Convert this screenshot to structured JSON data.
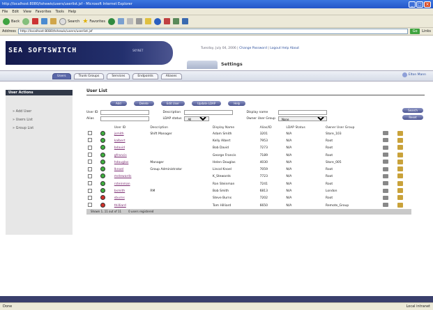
{
  "window": {
    "title": "http://localhost:8080/tshewis/users/userlist.jsf - Microsoft Internet Explorer"
  },
  "menu": [
    "File",
    "Edit",
    "View",
    "Favorites",
    "Tools",
    "Help"
  ],
  "toolbar": {
    "back": "Back",
    "search": "Search",
    "favorites": "Favorites"
  },
  "address": {
    "label": "Address",
    "url": "http://localhost:8080/tshewis/users/userlist.jsf",
    "go": "Go",
    "links": "Links"
  },
  "brand": {
    "logo": "SEA SOFTSWITCH",
    "sub": "SKYNET"
  },
  "topinfo": {
    "date": "Tuesday, July 04, 2006",
    "links": [
      "Change Password",
      "Logout",
      "Help",
      "About"
    ],
    "settings_label": "Settings"
  },
  "tabs": [
    {
      "label": "Users",
      "active": true
    },
    {
      "label": "Trunk Groups",
      "active": false
    },
    {
      "label": "Services",
      "active": false
    },
    {
      "label": "Endpoints",
      "active": false
    },
    {
      "label": "Aliases",
      "active": false
    }
  ],
  "user_link": "Elton Mann",
  "sidebar": {
    "title": "User Actions",
    "items": [
      "Add User",
      "Users List",
      "Group List"
    ]
  },
  "content": {
    "title": "User List"
  },
  "actions": [
    "Add",
    "Delete",
    "Edit User",
    "Update LDAP",
    "Help"
  ],
  "search": {
    "user_id": "User ID",
    "description": "Description",
    "display_name": "Display name",
    "alias": "Alias",
    "ldap_status": "LDAP status",
    "ldap_status_val": "All",
    "owner_group": "Owner User Group",
    "owner_group_val": "None",
    "search_btn": "Search",
    "reset_btn": "Reset"
  },
  "table": {
    "headers": [
      "",
      "",
      "User ID",
      "Description",
      "Display Name",
      "Alias/ID",
      "LDAP Status",
      "Owner User Group",
      "",
      ""
    ],
    "rows": [
      {
        "status": "green",
        "id": "jsmith",
        "desc": "Shift Manager",
        "name": "Adam Smith",
        "alias": "3201",
        "ldap": "N/A",
        "group": "Store_103"
      },
      {
        "status": "green",
        "id": "kalbert",
        "desc": "",
        "name": "Kelly Albert",
        "alias": "7953",
        "ldap": "N/A",
        "group": "Root"
      },
      {
        "status": "green",
        "id": "bdavid",
        "desc": "",
        "name": "Bob David",
        "alias": "7273",
        "ldap": "N/A",
        "group": "Root"
      },
      {
        "status": "green",
        "id": "gfrancis",
        "desc": "",
        "name": "George Francis",
        "alias": "7189",
        "ldap": "N/A",
        "group": "Root"
      },
      {
        "status": "green",
        "id": "hdouglas",
        "desc": "Manager",
        "name": "Helen Douglas",
        "alias": "4030",
        "ldap": "N/A",
        "group": "Store_005"
      },
      {
        "status": "green",
        "id": "lknoel",
        "desc": "Group Administrator",
        "name": "Lincol Knoel",
        "alias": "7059",
        "ldap": "N/A",
        "group": "Root"
      },
      {
        "status": "green",
        "id": "mstewards",
        "desc": "",
        "name": "K_Stewards",
        "alias": "7723",
        "ldap": "N/A",
        "group": "Root"
      },
      {
        "status": "green",
        "id": "rsteinman",
        "desc": "",
        "name": "Ron Steinman",
        "alias": "7241",
        "ldap": "N/A",
        "group": "Root"
      },
      {
        "status": "green",
        "id": "bsmith",
        "desc": "RM",
        "name": "Bob Smith",
        "alias": "6813",
        "ldap": "N/A",
        "group": "London"
      },
      {
        "status": "red",
        "id": "sburns",
        "desc": "",
        "name": "Steve Burns",
        "alias": "7202",
        "ldap": "N/A",
        "group": "Root"
      },
      {
        "status": "red",
        "id": "thilliard",
        "desc": "",
        "name": "Tom Hilliard",
        "alias": "6650",
        "ldap": "N/A",
        "group": "Remote_Group"
      }
    ],
    "footer": "Shown 1..11 out of 11",
    "footer2": "0 users registered"
  },
  "status": {
    "left": "Done",
    "right": "Local intranet"
  },
  "colors": {
    "banner": "#151b4d",
    "accent": "#4c5590",
    "active": "#3fb03f",
    "inactive": "#d0302a"
  }
}
